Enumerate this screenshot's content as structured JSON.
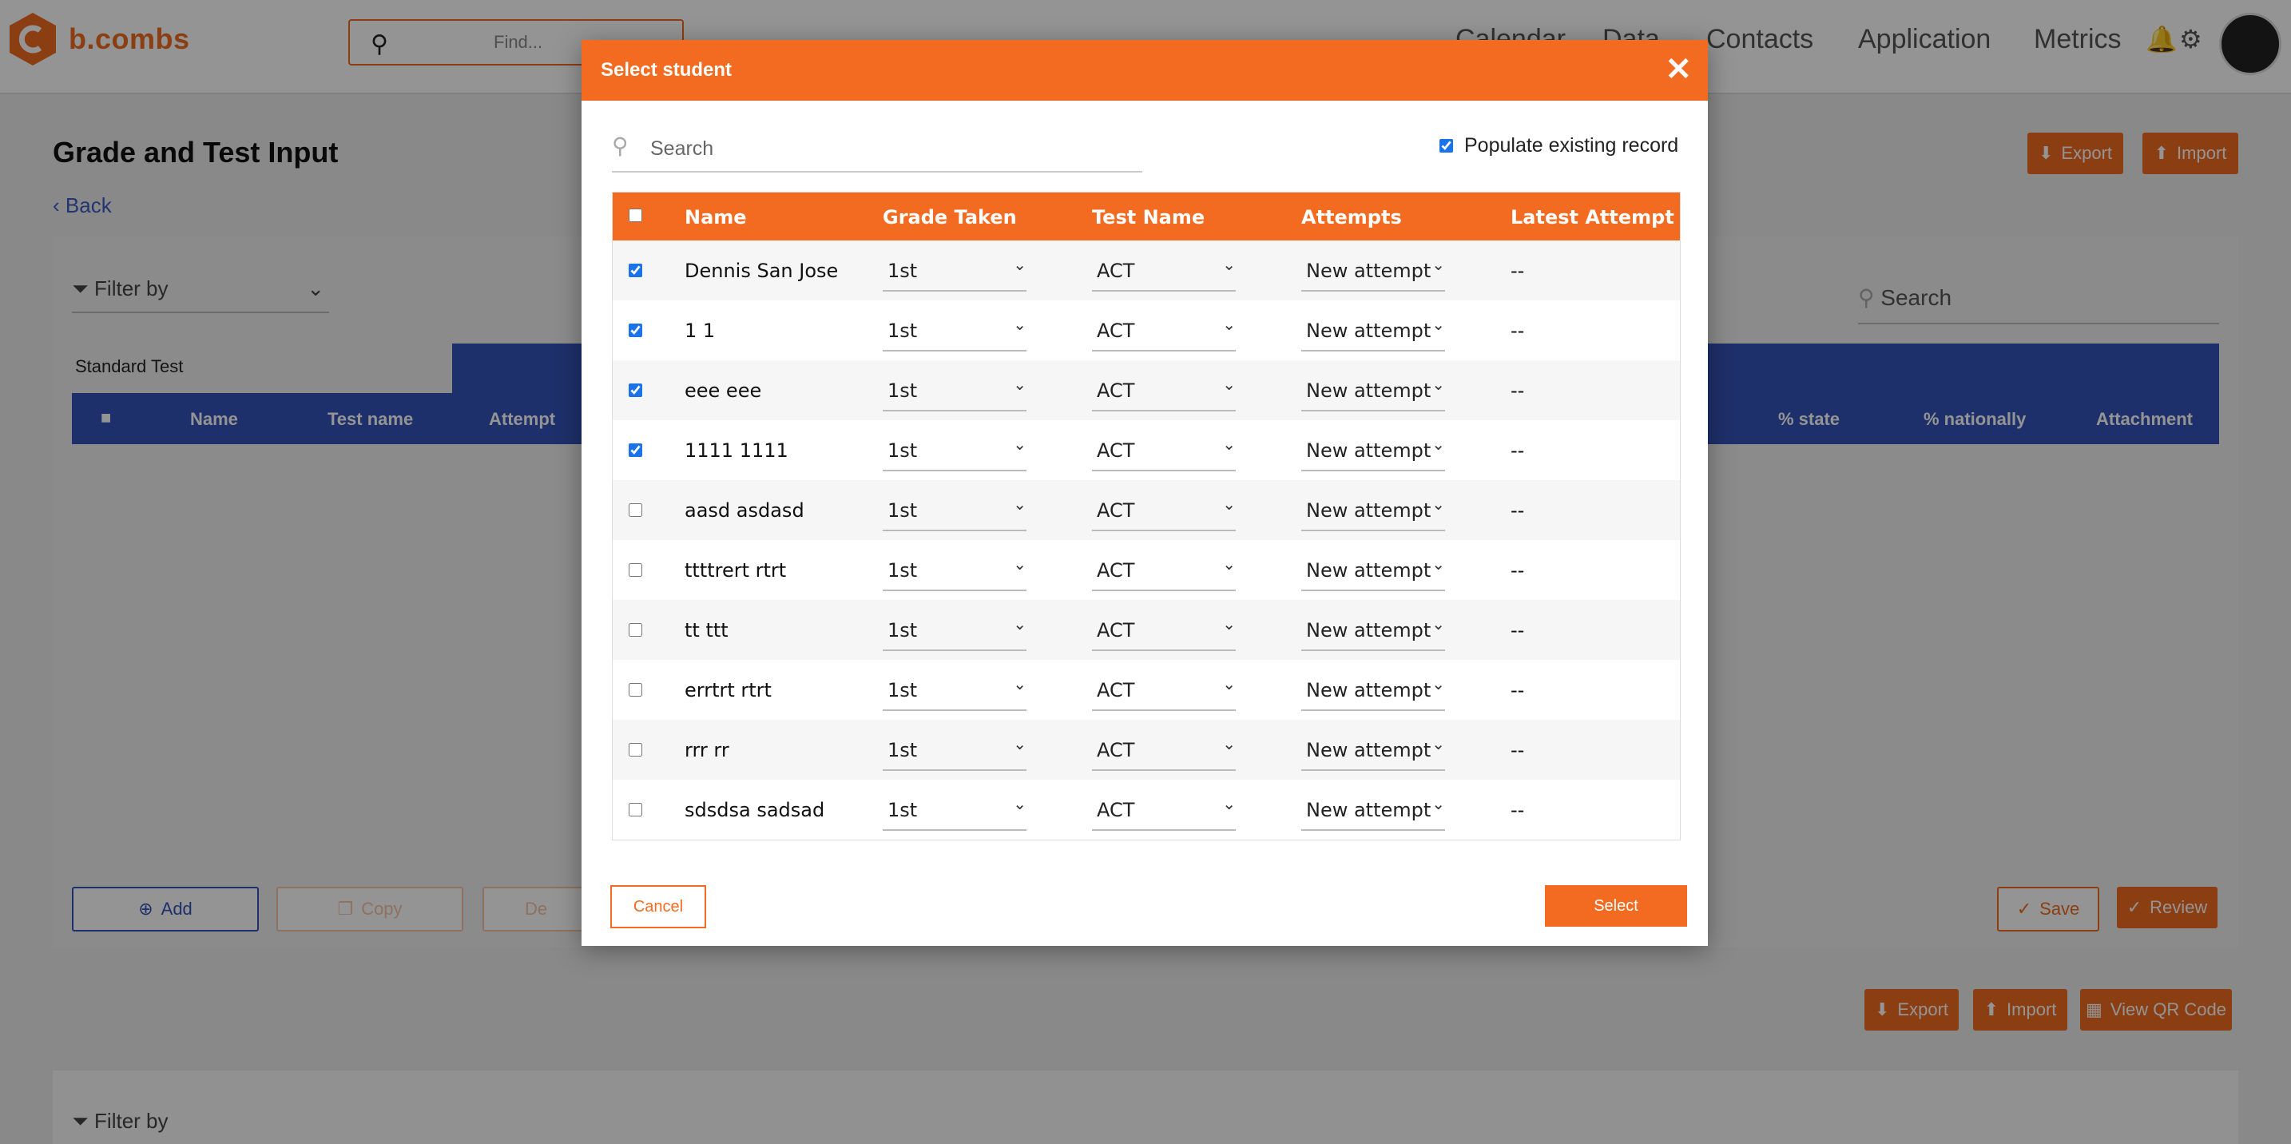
{
  "app": {
    "logo_text": "b.combs",
    "find_placeholder": "Find...",
    "nav": [
      "Calendar",
      "Data",
      "Contacts",
      "Application",
      "Metrics"
    ]
  },
  "page": {
    "title": "Grade and Test Input",
    "back_label": "Back",
    "export_label": "Export",
    "import_label": "Import",
    "filter_label": "Filter by",
    "search_placeholder": "Search",
    "section_label": "Standard Test",
    "columns": [
      "Name",
      "Test name",
      "Attempt",
      "% state",
      "% nationally",
      "Attachment"
    ],
    "add_label": "Add",
    "copy_label": "Copy",
    "delete_label": "De",
    "save_label": "Save",
    "review_label": "Review",
    "export2_label": "Export",
    "import2_label": "Import",
    "qr_label": "View QR Code",
    "filter2_label": "Filter by"
  },
  "modal": {
    "title": "Select student",
    "close_glyph": "✕",
    "search_placeholder": "Search",
    "populate_label": "Populate existing record",
    "populate_checked": true,
    "columns": [
      "Name",
      "Grade Taken",
      "Test Name",
      "Attempts",
      "Latest Attempt"
    ],
    "rows": [
      {
        "checked": true,
        "name": "Dennis San Jose",
        "grade": "1st",
        "test": "ACT",
        "attempt": "New attempt",
        "latest": "--"
      },
      {
        "checked": true,
        "name": "1 1",
        "grade": "1st",
        "test": "ACT",
        "attempt": "New attempt",
        "latest": "--"
      },
      {
        "checked": true,
        "name": "eee eee",
        "grade": "1st",
        "test": "ACT",
        "attempt": "New attempt",
        "latest": "--"
      },
      {
        "checked": true,
        "name": "1111 1111",
        "grade": "1st",
        "test": "ACT",
        "attempt": "New attempt",
        "latest": "--"
      },
      {
        "checked": false,
        "name": "aasd asdasd",
        "grade": "1st",
        "test": "ACT",
        "attempt": "New attempt",
        "latest": "--"
      },
      {
        "checked": false,
        "name": "ttttrert rtrt",
        "grade": "1st",
        "test": "ACT",
        "attempt": "New attempt",
        "latest": "--"
      },
      {
        "checked": false,
        "name": "tt ttt",
        "grade": "1st",
        "test": "ACT",
        "attempt": "New attempt",
        "latest": "--"
      },
      {
        "checked": false,
        "name": "errtrt rtrt",
        "grade": "1st",
        "test": "ACT",
        "attempt": "New attempt",
        "latest": "--"
      },
      {
        "checked": false,
        "name": "rrr rr",
        "grade": "1st",
        "test": "ACT",
        "attempt": "New attempt",
        "latest": "--"
      },
      {
        "checked": false,
        "name": "sdsdsa sadsad",
        "grade": "1st",
        "test": "ACT",
        "attempt": "New attempt",
        "latest": "--"
      }
    ],
    "cancel_label": "Cancel",
    "select_label": "Select"
  },
  "colors": {
    "accent": "#f26b21",
    "table_header_blue": "#3553b8",
    "link_blue": "#3b5bc4"
  },
  "icons": [
    "search-icon",
    "bell-icon",
    "gear-icon",
    "filter-icon",
    "close-icon",
    "chevron-down-icon",
    "upload-icon",
    "download-icon",
    "plus-circle-icon",
    "check-icon",
    "qr-icon"
  ]
}
